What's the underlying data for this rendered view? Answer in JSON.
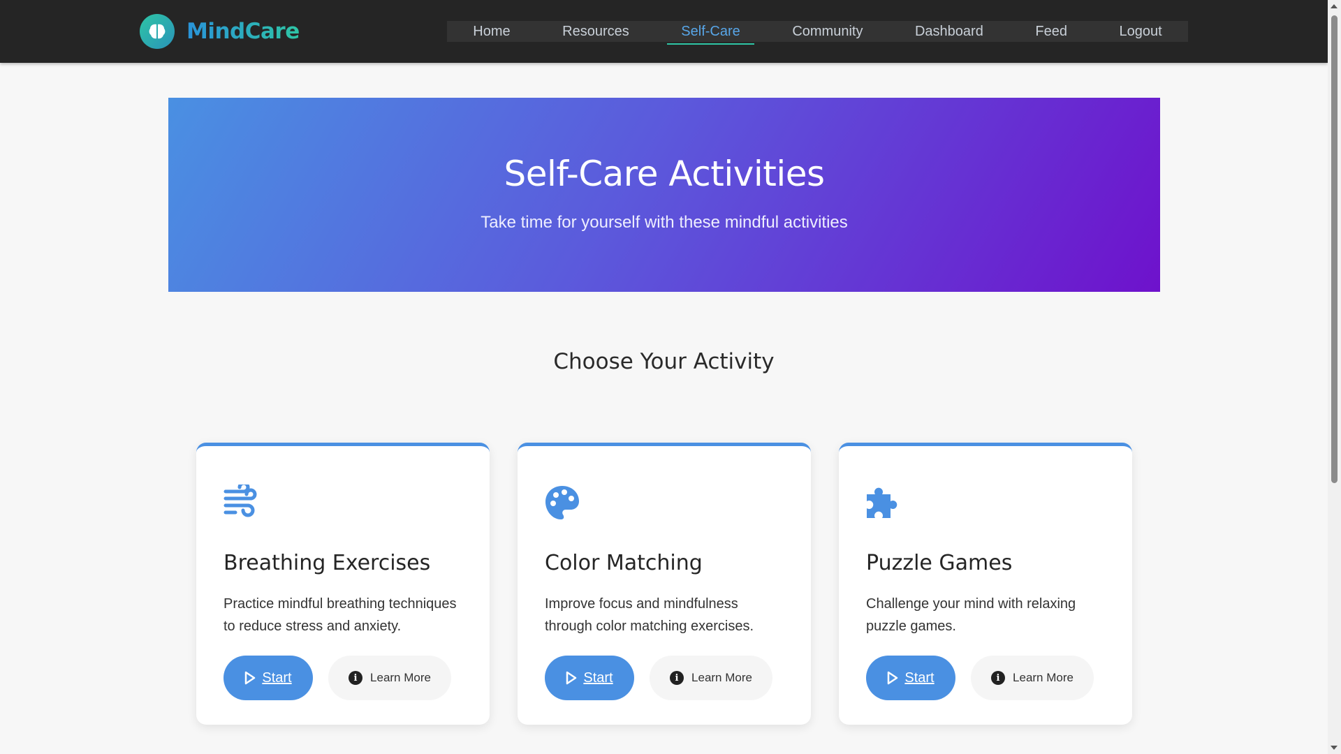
{
  "brand": {
    "name": "MindCare",
    "icon": "brain-icon"
  },
  "nav": {
    "items": [
      {
        "label": "Home"
      },
      {
        "label": "Resources"
      },
      {
        "label": "Self-Care",
        "active": true
      },
      {
        "label": "Community"
      },
      {
        "label": "Dashboard"
      },
      {
        "label": "Feed"
      },
      {
        "label": "Logout"
      }
    ]
  },
  "hero": {
    "title": "Self-Care Activities",
    "subtitle": "Take time for yourself with these mindful activities"
  },
  "section": {
    "title": "Choose Your Activity"
  },
  "cards": [
    {
      "icon": "wind-icon",
      "title": "Breathing Exercises",
      "description": "Practice mindful breathing techniques to reduce stress and anxiety.",
      "start_label": "Start",
      "more_label": "Learn More"
    },
    {
      "icon": "palette-icon",
      "title": "Color Matching",
      "description": "Improve focus and mindfulness through color matching exercises.",
      "start_label": "Start",
      "more_label": "Learn More"
    },
    {
      "icon": "puzzle-icon",
      "title": "Puzzle Games",
      "description": "Challenge your mind with relaxing puzzle games.",
      "start_label": "Start",
      "more_label": "Learn More"
    }
  ],
  "colors": {
    "accent": "#4a90e2",
    "nav_active": "#58a6e8",
    "header_bg": "#252525",
    "hero_gradient_start": "#4a90e2",
    "hero_gradient_end": "#6e12cc"
  }
}
